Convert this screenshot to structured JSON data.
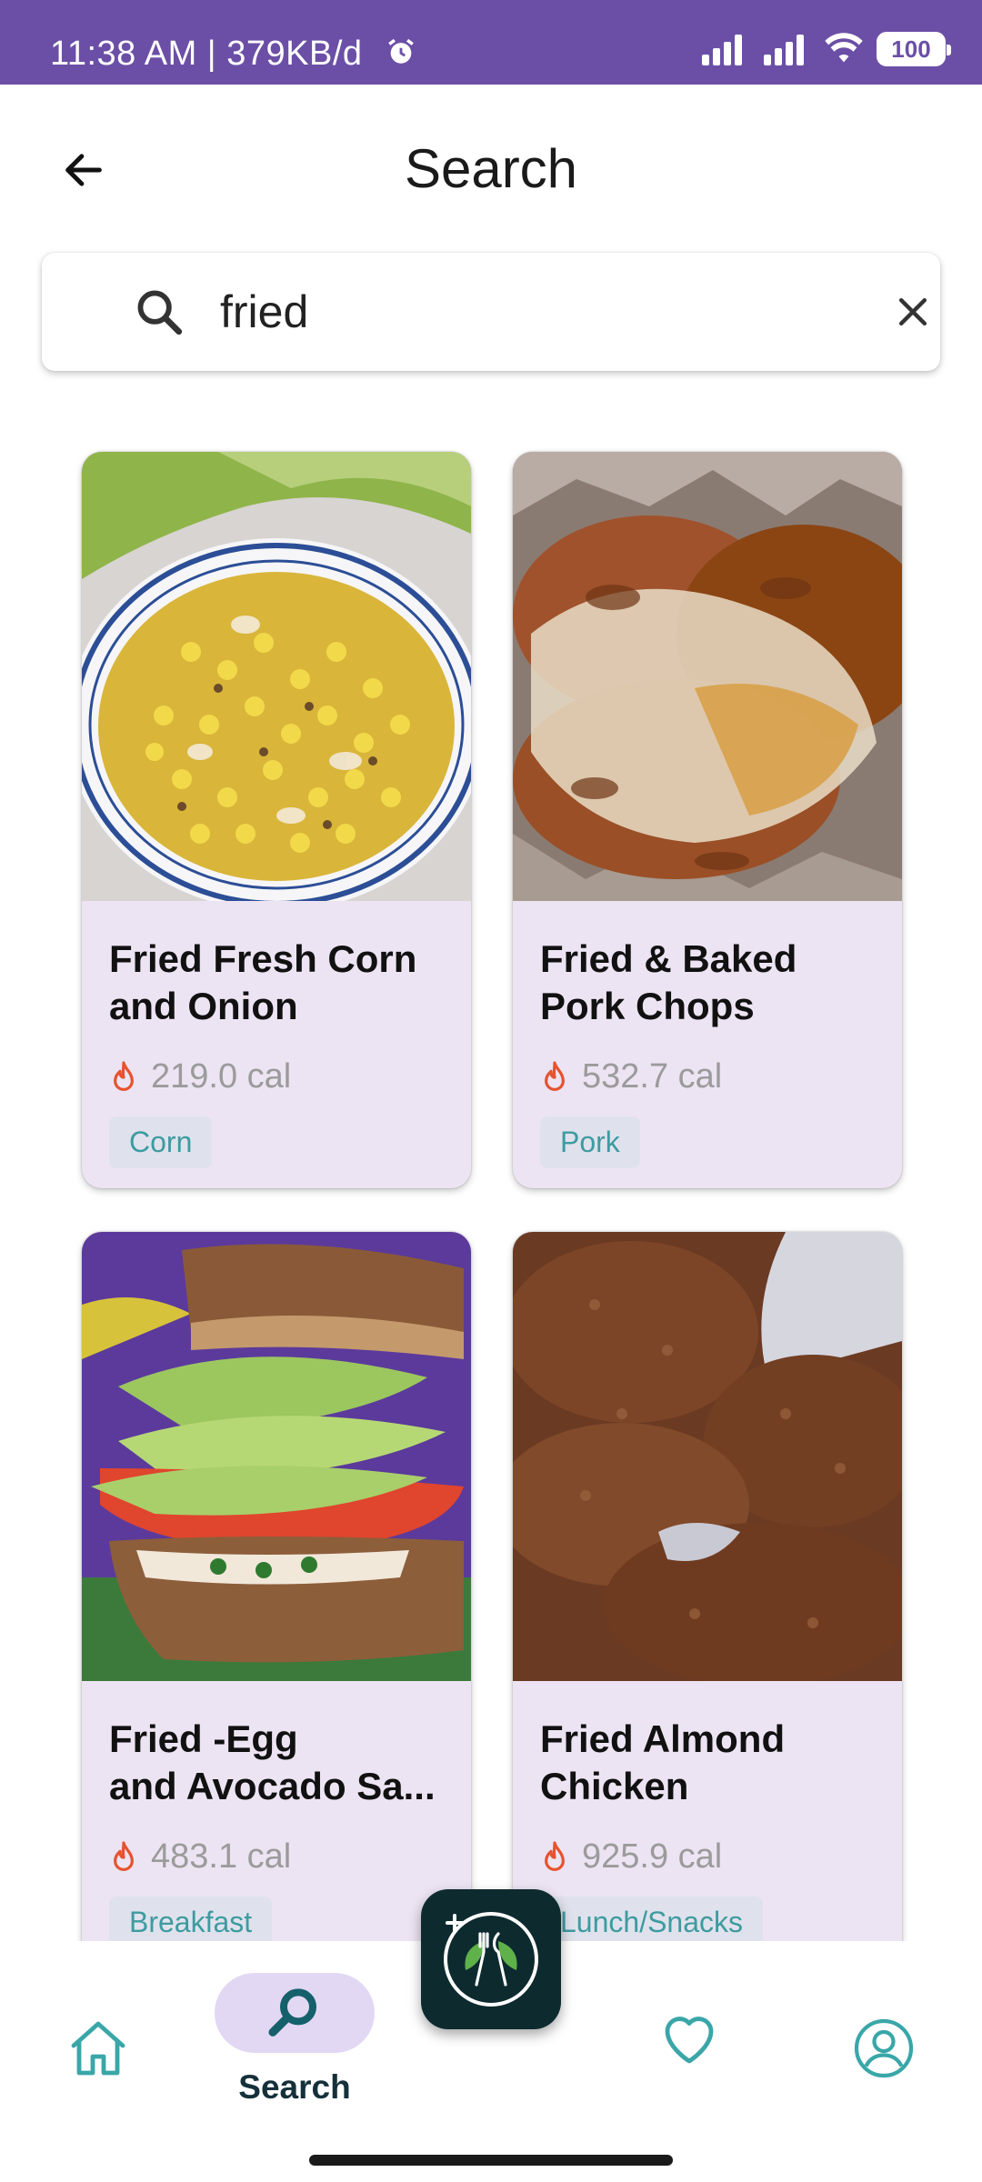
{
  "status_bar": {
    "time_text": "11:38 AM | 379KB/d",
    "battery": "100"
  },
  "header": {
    "title": "Search",
    "back_icon": "arrow-left-icon"
  },
  "search": {
    "value": "fried",
    "placeholder": "",
    "search_icon": "search-icon",
    "clear_icon": "close-icon"
  },
  "recipes": [
    {
      "title": "Fried  Fresh Corn\nand Onion",
      "calories": "219.0 cal",
      "tag": "Corn",
      "image": "corn-dish-photo"
    },
    {
      "title": "Fried & Baked\nPork Chops",
      "calories": "532.7 cal",
      "tag": "Pork",
      "image": "pork-chop-photo"
    },
    {
      "title": "Fried -Egg\nand Avocado Sa...",
      "calories": "483.1 cal",
      "tag": "Breakfast",
      "image": "avocado-sandwich-photo"
    },
    {
      "title": "Fried Almond\nChicken",
      "calories": "925.9 cal",
      "tag": "Lunch/Snacks",
      "image": "fried-chicken-photo"
    }
  ],
  "bottom_nav": {
    "home_icon": "home-icon",
    "search_label": "Search",
    "search_icon": "search-icon",
    "fab_icon": "add-meal-logo-icon",
    "favorites_icon": "heart-icon",
    "profile_icon": "profile-icon"
  },
  "colors": {
    "status_bar": "#6b4fa6",
    "card_bg": "#ede4f3",
    "tag_text": "#3e9ba0",
    "flame": "#e5532f",
    "nav_accent": "#3aa6a8"
  }
}
